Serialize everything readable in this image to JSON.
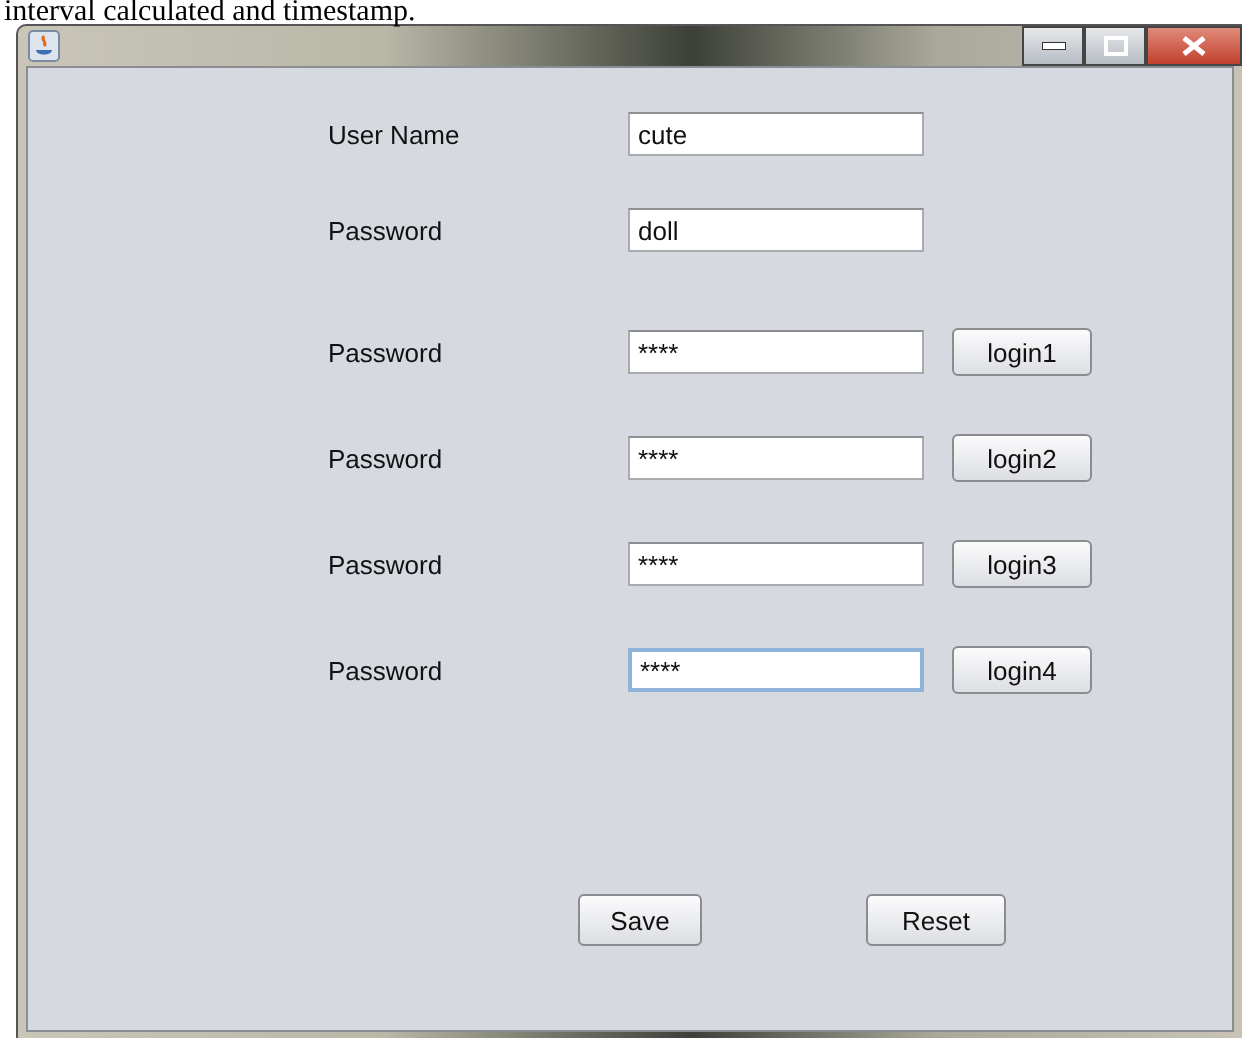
{
  "page_text": "interval calculated and timestamp.",
  "window": {
    "title_bar_buttons": [
      {
        "kind": "minimize"
      },
      {
        "kind": "maximize"
      },
      {
        "kind": "close"
      }
    ]
  },
  "form": {
    "rows": [
      {
        "label": "User Name",
        "value": "cute",
        "focused": false
      },
      {
        "label": "Password",
        "value": "doll",
        "focused": false
      },
      {
        "label": "Password",
        "value": "****",
        "focused": false,
        "button": "login1"
      },
      {
        "label": "Password",
        "value": "****",
        "focused": false,
        "button": "login2"
      },
      {
        "label": "Password",
        "value": "****",
        "focused": false,
        "button": "login3"
      },
      {
        "label": "Password",
        "value": "****",
        "focused": true,
        "button": "login4"
      }
    ]
  },
  "buttons": [
    "Save",
    "Reset"
  ]
}
